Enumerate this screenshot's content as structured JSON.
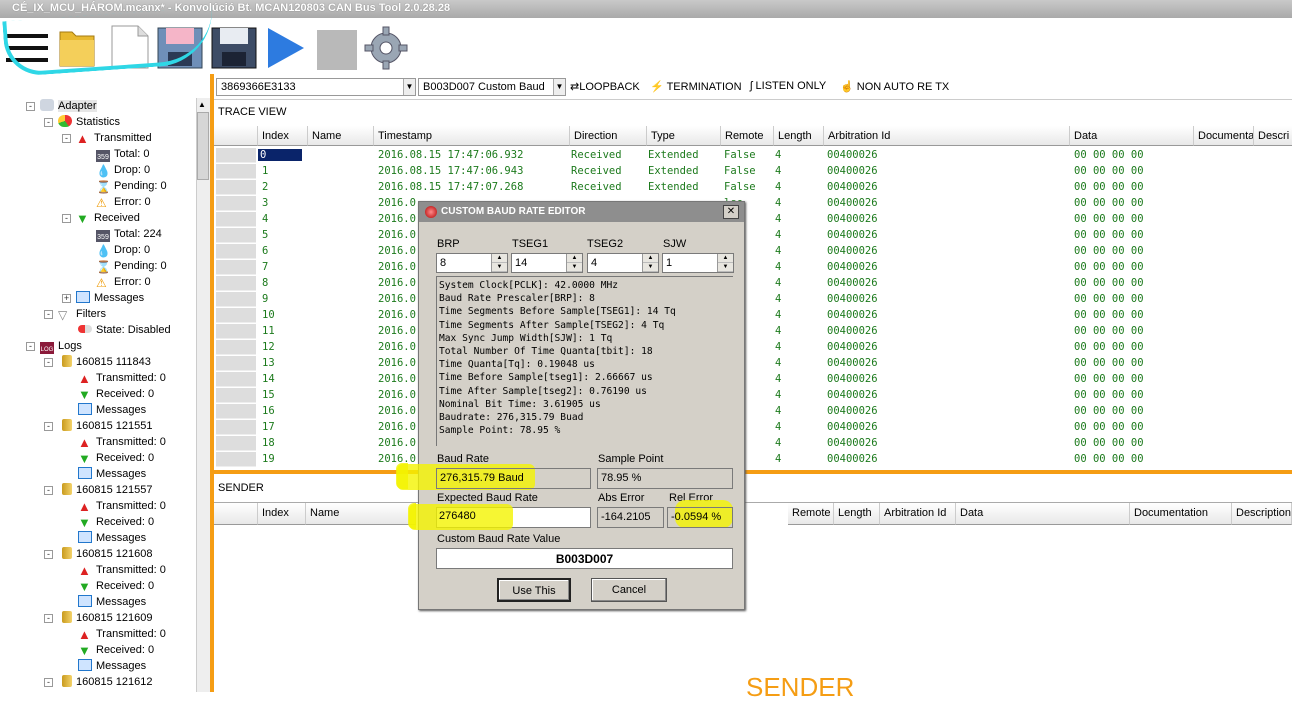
{
  "window": {
    "title": "CÉ_IX_MCU_HÁROM.mcanx* - Konvolúció Bt. MCAN120803 CAN Bus Tool 2.0.28.28"
  },
  "toolbar": {
    "icons": [
      "menu-icon",
      "open-folder-icon",
      "new-file-icon",
      "save-as-icon",
      "save-icon",
      "play-icon",
      "stop-icon",
      "settings-gear-icon"
    ]
  },
  "topbar": {
    "device": "3869366E3133",
    "baud": "B003D007 Custom Baud",
    "loopback": "LOOPBACK",
    "termination": "TERMINATION",
    "listen_only": "LISTEN ONLY",
    "non_auto_retx": "NON AUTO RE TX"
  },
  "tree": {
    "adapter": "Adapter",
    "statistics": "Statistics",
    "transmitted": "Transmitted",
    "tx_total": "Total: 0",
    "tx_drop": "Drop: 0",
    "tx_pending": "Pending: 0",
    "tx_error": "Error: 0",
    "received": "Received",
    "rx_total": "Total: 224",
    "rx_drop": "Drop: 0",
    "rx_pending": "Pending: 0",
    "rx_error": "Error: 0",
    "messages": "Messages",
    "filters": "Filters",
    "state": "State: Disabled",
    "logs": "Logs",
    "log_entries": [
      {
        "name": "160815 111843",
        "tx": "Transmitted: 0",
        "rx": "Received: 0",
        "msg": "Messages"
      },
      {
        "name": "160815 121551",
        "tx": "Transmitted: 0",
        "rx": "Received: 0",
        "msg": "Messages"
      },
      {
        "name": "160815 121557",
        "tx": "Transmitted: 0",
        "rx": "Received: 0",
        "msg": "Messages"
      },
      {
        "name": "160815 121608",
        "tx": "Transmitted: 0",
        "rx": "Received: 0",
        "msg": "Messages"
      },
      {
        "name": "160815 121609",
        "tx": "Transmitted: 0",
        "rx": "Received: 0",
        "msg": "Messages"
      },
      {
        "name": "160815 121612",
        "tx": "",
        "rx": "",
        "msg": ""
      }
    ]
  },
  "trace": {
    "title": "TRACE VIEW",
    "columns": [
      "Index",
      "Name",
      "Timestamp",
      "Direction",
      "Type",
      "Remote",
      "Length",
      "Arbitration Id",
      "Data",
      "Documenta",
      "Descri"
    ],
    "rows": [
      [
        "0",
        "",
        "2016.08.15 17:47:06.932",
        "Received",
        "Extended",
        "False",
        "4",
        "00400026",
        "00 00 00 00"
      ],
      [
        "1",
        "",
        "2016.08.15 17:47:06.943",
        "Received",
        "Extended",
        "False",
        "4",
        "00400026",
        "00 00 00 00"
      ],
      [
        "2",
        "",
        "2016.08.15 17:47:07.268",
        "Received",
        "Extended",
        "False",
        "4",
        "00400026",
        "00 00 00 00"
      ],
      [
        "3",
        "",
        "2016.0",
        "",
        "",
        "lse",
        "4",
        "00400026",
        "00 00 00 00"
      ],
      [
        "4",
        "",
        "2016.0",
        "",
        "",
        "lse",
        "4",
        "00400026",
        "00 00 00 00"
      ],
      [
        "5",
        "",
        "2016.0",
        "",
        "",
        "lse",
        "4",
        "00400026",
        "00 00 00 00"
      ],
      [
        "6",
        "",
        "2016.0",
        "",
        "",
        "lse",
        "4",
        "00400026",
        "00 00 00 00"
      ],
      [
        "7",
        "",
        "2016.0",
        "",
        "",
        "lse",
        "4",
        "00400026",
        "00 00 00 00"
      ],
      [
        "8",
        "",
        "2016.0",
        "",
        "",
        "lse",
        "4",
        "00400026",
        "00 00 00 00"
      ],
      [
        "9",
        "",
        "2016.0",
        "",
        "",
        "lse",
        "4",
        "00400026",
        "00 00 00 00"
      ],
      [
        "10",
        "",
        "2016.0",
        "",
        "",
        "lse",
        "4",
        "00400026",
        "00 00 00 00"
      ],
      [
        "11",
        "",
        "2016.0",
        "",
        "",
        "lse",
        "4",
        "00400026",
        "00 00 00 00"
      ],
      [
        "12",
        "",
        "2016.0",
        "",
        "",
        "lse",
        "4",
        "00400026",
        "00 00 00 00"
      ],
      [
        "13",
        "",
        "2016.0",
        "",
        "",
        "lse",
        "4",
        "00400026",
        "00 00 00 00"
      ],
      [
        "14",
        "",
        "2016.0",
        "",
        "",
        "lse",
        "4",
        "00400026",
        "00 00 00 00"
      ],
      [
        "15",
        "",
        "2016.0",
        "",
        "",
        "lse",
        "4",
        "00400026",
        "00 00 00 00"
      ],
      [
        "16",
        "",
        "2016.0",
        "",
        "",
        "lse",
        "4",
        "00400026",
        "00 00 00 00"
      ],
      [
        "17",
        "",
        "2016.0",
        "",
        "",
        "lse",
        "4",
        "00400026",
        "00 00 00 00"
      ],
      [
        "18",
        "",
        "2016.0",
        "",
        "",
        "lse",
        "4",
        "00400026",
        "00 00 00 00"
      ],
      [
        "19",
        "",
        "2016.0",
        "",
        "",
        "lse",
        "4",
        "00400026",
        "00 00 00 00"
      ]
    ]
  },
  "sender": {
    "title": "SENDER",
    "columns": [
      "Index",
      "Name",
      "Remote",
      "Length",
      "Arbitration Id",
      "Data",
      "Documentation",
      "Description"
    ],
    "footer": "SENDER"
  },
  "dialog": {
    "title": "CUSTOM BAUD RATE EDITOR",
    "brp_label": "BRP",
    "tseg1_label": "TSEG1",
    "tseg2_label": "TSEG2",
    "sjw_label": "SJW",
    "brp": "8",
    "tseg1": "14",
    "tseg2": "4",
    "sjw": "1",
    "calc_lines": [
      "System Clock[PCLK]: 42.0000 MHz",
      "Baud Rate Prescaler[BRP]: 8",
      "Time Segments Before Sample[TSEG1]: 14 Tq",
      "Time Segments After Sample[TSEG2]: 4 Tq",
      "Max Sync Jump Width[SJW]: 1 Tq",
      "Total Number Of Time Quanta[tbit]: 18",
      "Time Quanta[Tq]: 0.19048 us",
      "Time Before Sample[tseg1]: 2.66667 us",
      "Time After Sample[tseg2]: 0.76190 us",
      "Nominal Bit Time: 3.61905 us",
      "Baudrate: 276,315.79 Buad",
      "Sample Point: 78.95 %"
    ],
    "baud_rate_label": "Baud Rate",
    "baud_rate": "276,315.79 Baud",
    "sample_point_label": "Sample Point",
    "sample_point": "78.95 %",
    "expected_label": "Expected Baud Rate",
    "expected": "276480",
    "abs_error_label": "Abs Error",
    "abs_error": "-164.2105",
    "rel_error_label": "Rel Error",
    "rel_error": "-0.0594 %",
    "custom_label": "Custom Baud Rate Value",
    "custom_value": "B003D007",
    "use_btn": "Use This",
    "cancel_btn": "Cancel"
  },
  "colors": {
    "accent_orange": "#f59d14",
    "highlight_yellow": "#f4f400",
    "annotation_cyan": "#2fd7e6",
    "data_green": "#1c7a1c"
  }
}
